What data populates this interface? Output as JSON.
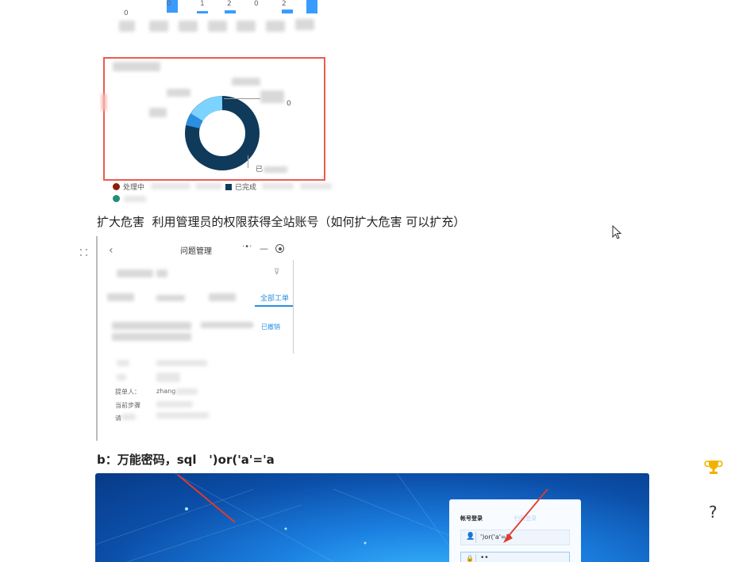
{
  "top_chart": {
    "ticks": [
      "0",
      "0",
      "1",
      "2",
      "0",
      "2"
    ]
  },
  "donut_panel": {
    "label_right_zero": "0",
    "label_bottom": "已",
    "legend": [
      {
        "label": "处理中",
        "color": "#8b1e0a"
      },
      {
        "label": "已完成",
        "color": "#0f3a5a"
      }
    ]
  },
  "paragraph_1": "扩大危害  利用管理员的权限获得全站账号（如何扩大危害 可以扩充）",
  "mobile": {
    "title": "问题管理",
    "tab_all": "全部工单",
    "status": "已撤销",
    "field_submitter": "提单人：",
    "field_submitter_value": "zhang",
    "field_step": "当前步骤",
    "field_process": "请"
  },
  "paragraph_2": "b：万能密码，sql   ')or('a'='a",
  "login": {
    "tab_account": "帐号登录",
    "tab_other": "扫码登录",
    "username_value": "')or('a'='a",
    "password_value": "••"
  },
  "icons": {
    "trophy_color": "#f0b400",
    "help": "?"
  }
}
